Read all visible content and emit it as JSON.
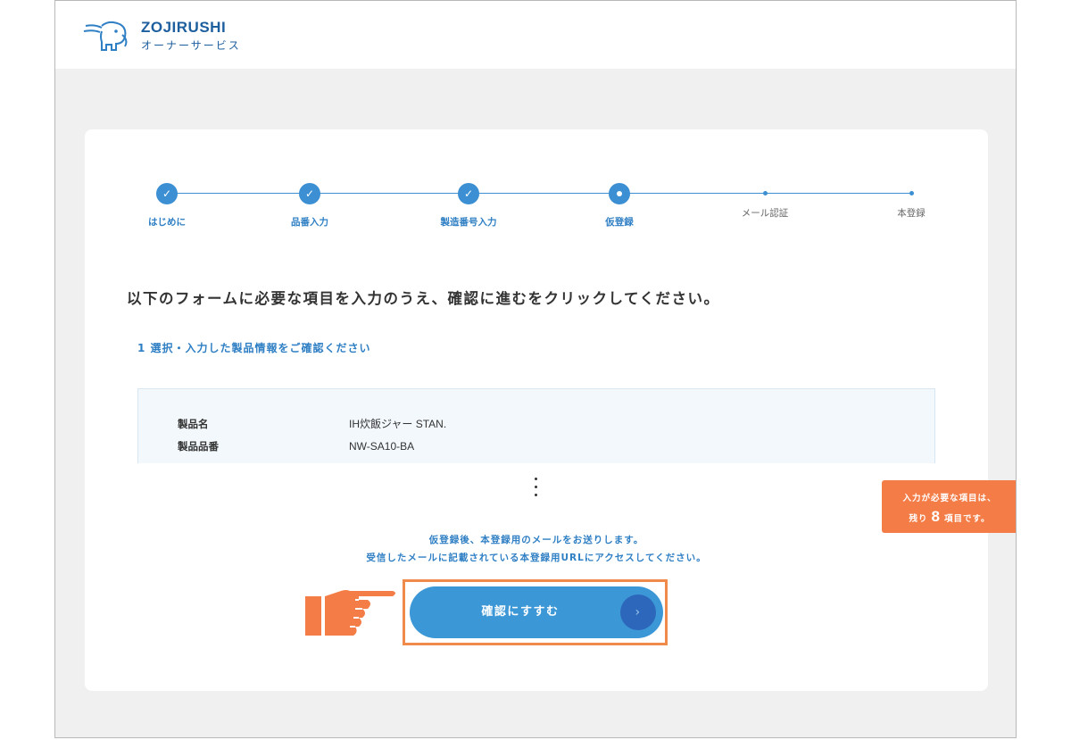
{
  "header": {
    "brand": "ZOJIRUSHI",
    "subtitle": "オーナーサービス"
  },
  "stepper": {
    "steps": [
      {
        "label": "はじめに",
        "state": "done"
      },
      {
        "label": "品番入力",
        "state": "done"
      },
      {
        "label": "製造番号入力",
        "state": "done"
      },
      {
        "label": "仮登録",
        "state": "current"
      },
      {
        "label": "メール認証",
        "state": "pending"
      },
      {
        "label": "本登録",
        "state": "pending"
      }
    ],
    "check_glyph": "✓"
  },
  "instruction": "以下のフォームに必要な項目を入力のうえ、確認に進むをクリックしてください。",
  "section": {
    "title": "1 選択・入力した製品情報をご確認ください"
  },
  "product": {
    "rows": [
      {
        "label": "製品名",
        "value": "IH炊飯ジャー STAN."
      },
      {
        "label": "製品品番",
        "value": "NW-SA10-BA"
      }
    ]
  },
  "notice": {
    "line1": "仮登録後、本登録用のメールをお送りします。",
    "line2": "受信したメールに記載されている本登録用URLにアクセスしてください。"
  },
  "cta": {
    "label": "確認にすすむ",
    "arrow": "›"
  },
  "badge": {
    "line1": "入力が必要な項目は、",
    "prefix": "残り",
    "count": "8",
    "suffix": "項目です。"
  },
  "colors": {
    "accent": "#3b97d6",
    "brand": "#1d5f9e",
    "highlight": "#f08a4b",
    "badge": "#f47d47"
  },
  "icons": {
    "logo": "elephant-logo-icon",
    "pointer": "pointing-hand-icon",
    "arrow": "chevron-right-icon"
  }
}
